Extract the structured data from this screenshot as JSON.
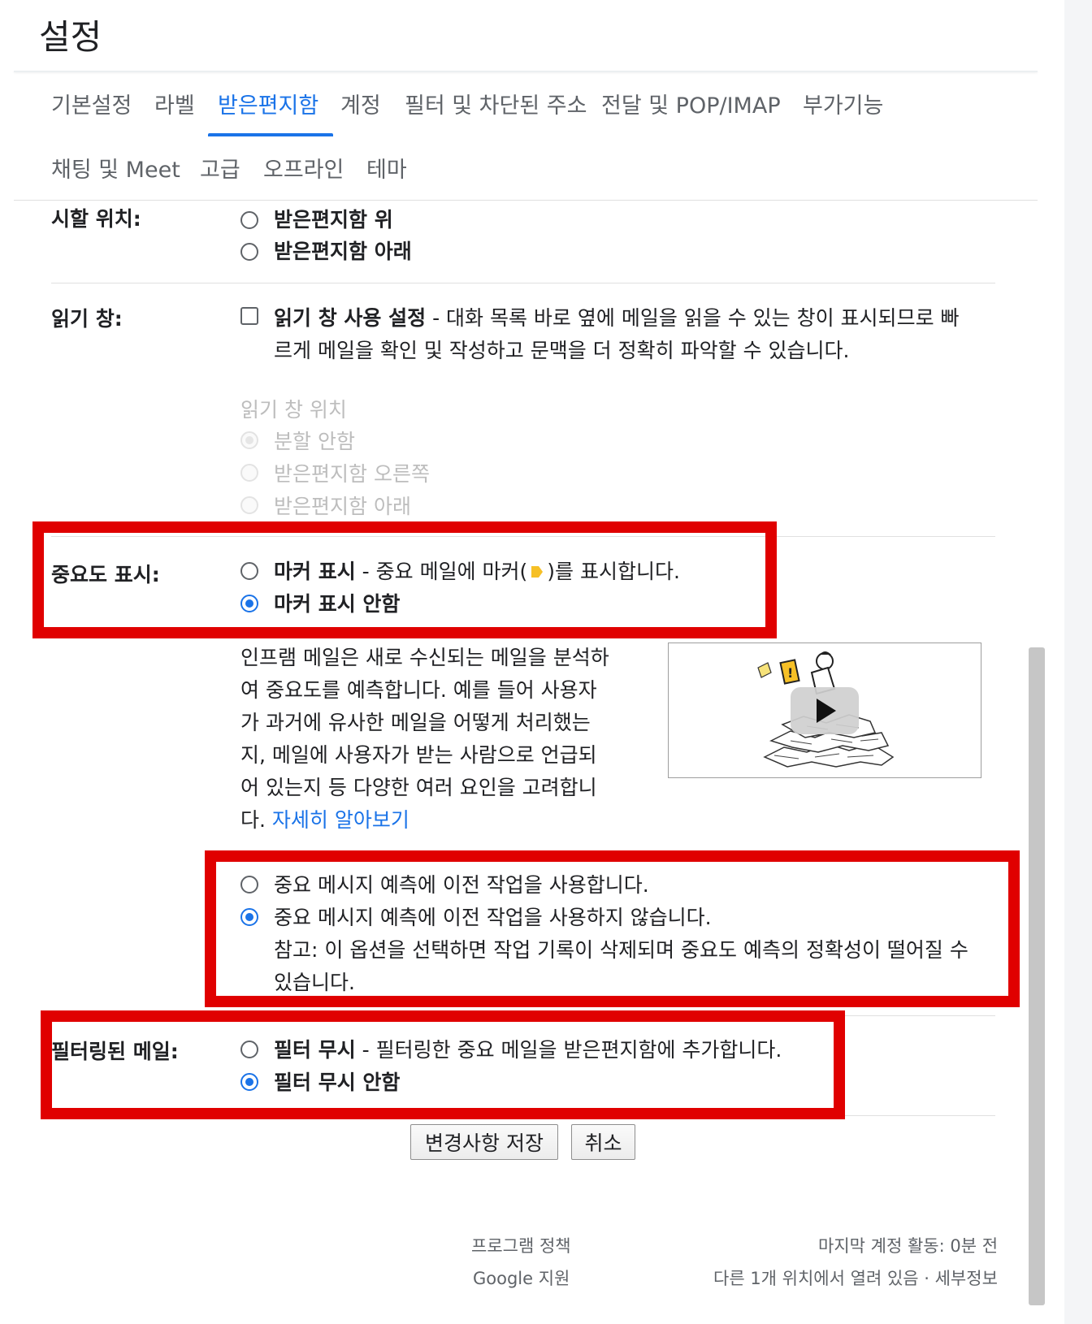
{
  "header": {
    "title": "설정"
  },
  "tabs": [
    {
      "label": "기본설정"
    },
    {
      "label": "라벨"
    },
    {
      "label": "받은편지함"
    },
    {
      "label": "계정"
    },
    {
      "label": "필터 및 차단된 주소"
    },
    {
      "label": "전달 및 POP/IMAP"
    },
    {
      "label": "부가기능"
    },
    {
      "label": "채팅 및 Meet"
    },
    {
      "label": "고급"
    },
    {
      "label": "오프라인"
    },
    {
      "label": "테마"
    }
  ],
  "active_tab": "받은편지함",
  "start_position": {
    "label": "시할 위치:",
    "options": [
      "받은편지함 위",
      "받은편지함 아래"
    ]
  },
  "reading_pane": {
    "label": "읽기 창:",
    "checkbox_title": "읽기 창 사용 설정",
    "checkbox_desc_line1": " - 대화 목록 바로 옆에 메일을 읽을 수 있는 창이 표시되므로 빠",
    "checkbox_desc_line2": "르게 메일을 확인 및 작성하고 문맥을 더 정확히 파악할 수 있습니다.",
    "position_title": "읽기 창 위치",
    "position_options": [
      "분할 안함",
      "받은편지함 오른쪽",
      "받은편지함 아래"
    ]
  },
  "importance": {
    "label": "중요도 표시:",
    "option1_title": "마커 표시",
    "option1_desc_a": " - 중요 메일에 마커(",
    "option1_desc_b": ")를 표시합니다.",
    "option2_title": "마커 표시 안함",
    "selected": "마커 표시 안함",
    "info_lines": [
      "인프램 메일은 새로 수신되는 메일을 분석하",
      "여 중요도를 예측합니다. 예를 들어 사용자",
      "가 과거에 유사한 메일을 어떻게 처리했는",
      "지, 메일에 사용자가 받는 사람으로 언급되",
      "어 있는지 등 다양한 여러 요인을 고려합니"
    ],
    "info_last_prefix": "다. ",
    "learn_more": "자세히 알아보기"
  },
  "prediction": {
    "option1": "중요 메시지 예측에 이전 작업을 사용합니다.",
    "option2": "중요 메시지 예측에 이전 작업을 사용하지 않습니다.",
    "note_line1": "참고: 이 옵션을 선택하면 작업 기록이 삭제되며 중요도 예측의 정확성이 떨어질 수",
    "note_line2": "있습니다.",
    "selected": "중요 메시지 예측에 이전 작업을 사용하지 않습니다."
  },
  "filtered": {
    "label": "필터링된 메일:",
    "option1_title": "필터 무시",
    "option1_desc": " - 필터링한 중요 메일을 받은편지함에 추가합니다.",
    "option2_title": "필터 무시 안함",
    "selected": "필터 무시 안함"
  },
  "buttons": {
    "save": "변경사항 저장",
    "cancel": "취소"
  },
  "footer": {
    "program_policy": "프로그램 정책",
    "google_support": "Google 지원",
    "last_activity": "마지막 계정 활동: 0분 전",
    "open_elsewhere": "다른 1개 위치에서 열려 있음 · 세부정보"
  },
  "colors": {
    "accent": "#1a73e8",
    "highlight_box": "#e00000",
    "marker": "#f6c026"
  }
}
